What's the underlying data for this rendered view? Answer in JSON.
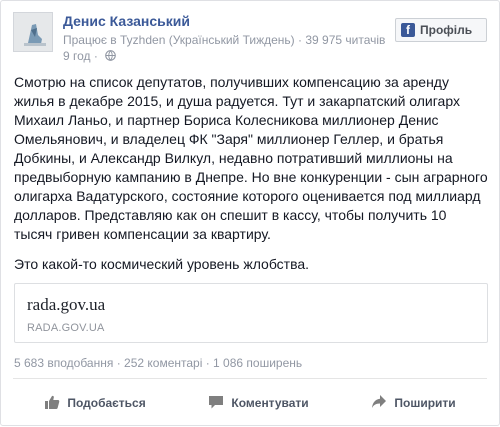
{
  "post": {
    "author": "Денис Казанський",
    "workplace": "Працює в Tyzhden (Український Тиждень)",
    "followers": "39 975 читачів",
    "separator": " · ",
    "time": "9 год",
    "profile_button": "Профіль",
    "text": "Смотрю на список депутатов, получивших компенсацию за аренду жилья в декабре 2015, и душа радуется. Тут и закарпатский олигарх Михаил Ланьо, и партнер Бориса Колесникова миллионер Денис Омельянович, и владелец ФК \"Заря\" миллионер Геллер, и братья Добкины, и Александр Вилкул, недавно потративший миллионы на предвыборную кампанию в Днепре. Но вне конкуренции - сын аграрного олигарха Вадатурского, состояние которого оценивается под миллиард долларов. Представляю как он спешит в кассу, чтобы получить 10 тысяч гривен компенсации за квартиру.",
    "text2": "Это какой-то космический уровень жлобства.",
    "link": {
      "title": "rada.gov.ua",
      "domain": "RADA.GOV.UA"
    },
    "stats": {
      "likes": "5 683 вподобання",
      "comments": "252 коментарі",
      "shares": "1 086 поширень",
      "dot": " · "
    },
    "actions": {
      "like": "Подобається",
      "comment": "Коментувати",
      "share": "Поширити"
    }
  },
  "colors": {
    "author_link": "#3b5998",
    "meta": "#9197a3",
    "text": "#141823"
  },
  "icons": [
    "avatar-image",
    "facebook-logo-icon",
    "globe-icon",
    "like-icon",
    "comment-icon",
    "share-icon"
  ]
}
